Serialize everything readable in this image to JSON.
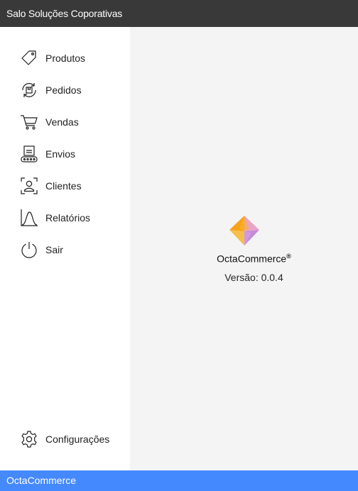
{
  "window": {
    "title": "Salo Soluções Coporativas"
  },
  "sidebar": {
    "items": [
      {
        "label": "Produtos",
        "icon": "tag-icon"
      },
      {
        "label": "Pedidos",
        "icon": "order-cycle-icon"
      },
      {
        "label": "Vendas",
        "icon": "shopping-cart-icon"
      },
      {
        "label": "Envios",
        "icon": "delivery-icon"
      },
      {
        "label": "Clientes",
        "icon": "user-frame-icon"
      },
      {
        "label": "Relatórios",
        "icon": "bell-curve-icon"
      },
      {
        "label": "Sair",
        "icon": "power-icon"
      }
    ],
    "settings": {
      "label": "Configurações",
      "icon": "gear-icon"
    }
  },
  "about": {
    "product_name": "OctaCommerce",
    "trademark": "®",
    "version_text": "Versão: 0.0.4"
  },
  "statusbar": {
    "text": "OctaCommerce"
  },
  "colors": {
    "titlebar": "#393939",
    "statusbar": "#4589ff",
    "sidebar": "#ffffff",
    "main": "#f4f4f4"
  }
}
